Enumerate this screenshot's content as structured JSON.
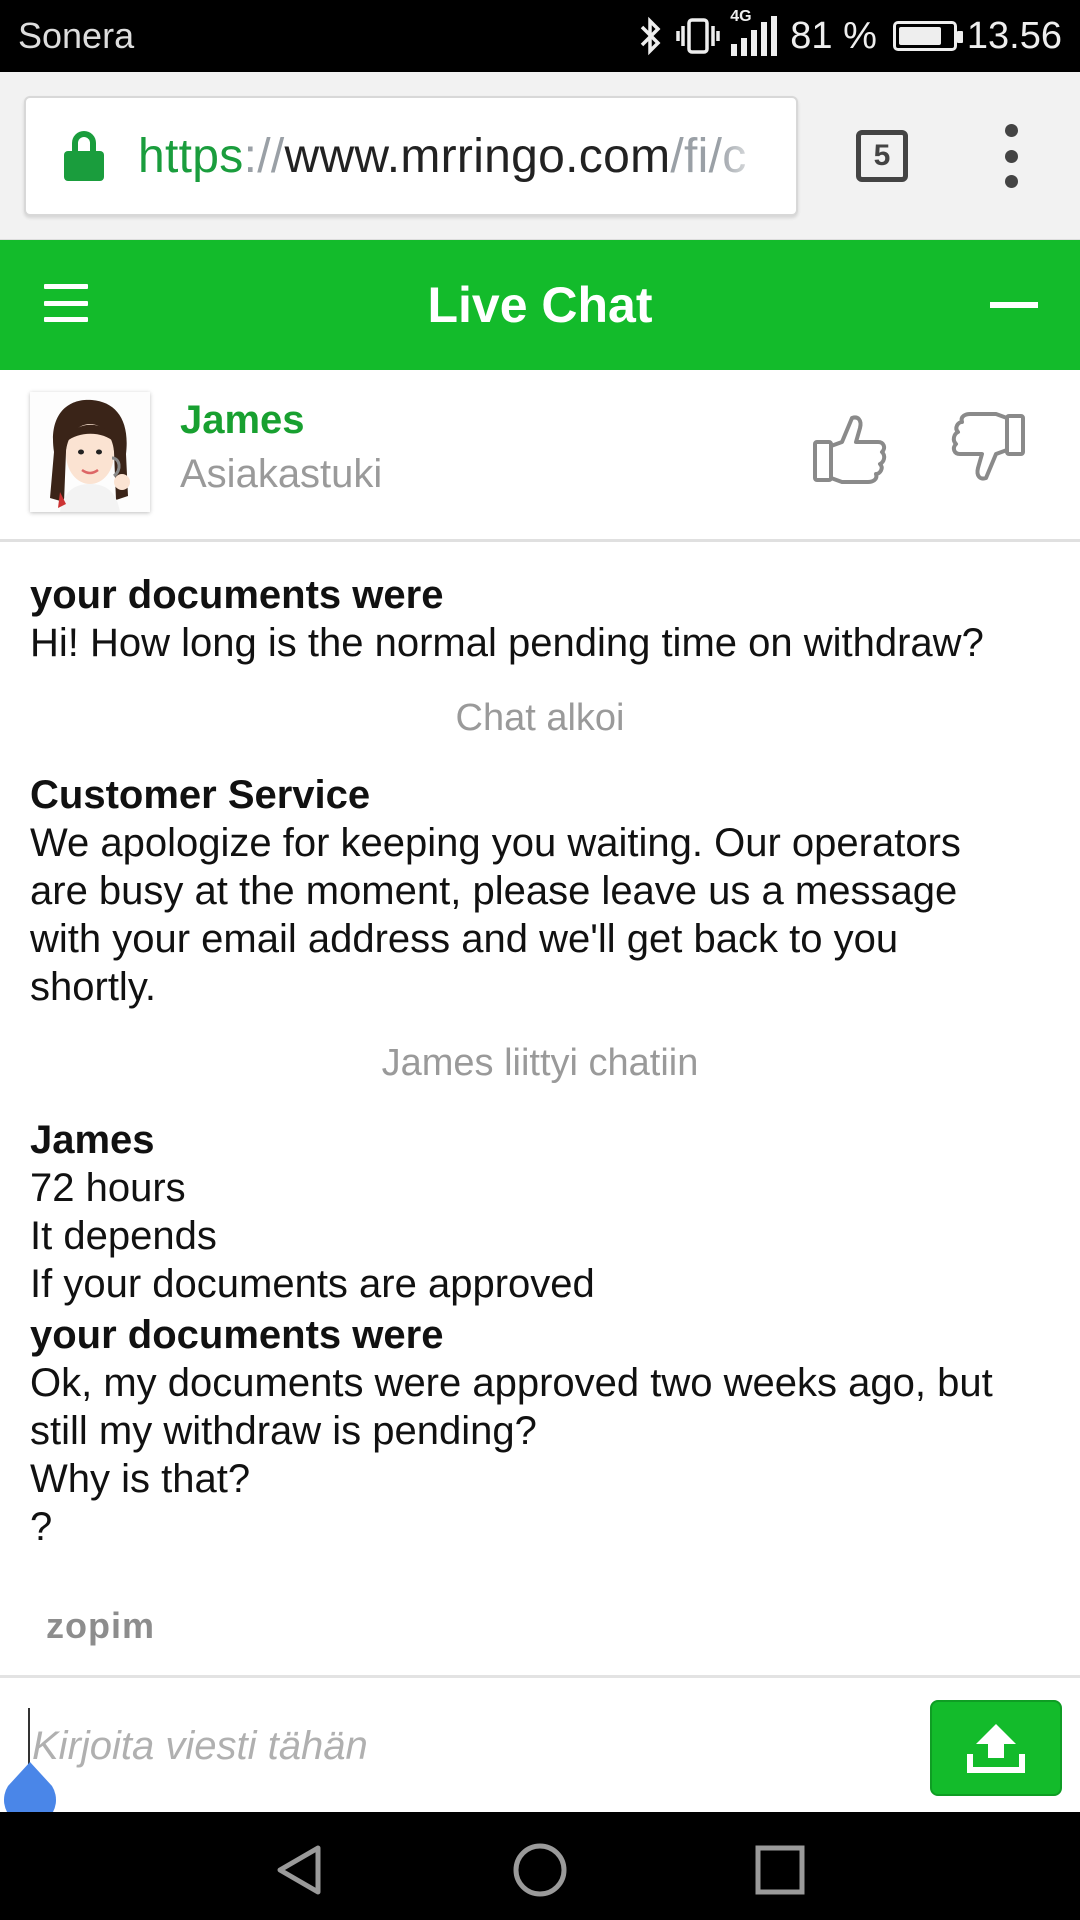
{
  "status_bar": {
    "carrier": "Sonera",
    "network": "4G",
    "battery_text": "81 %",
    "battery_level": 0.81,
    "time": "13.56",
    "icons": [
      "bluetooth-icon",
      "vibrate-icon",
      "signal-icon",
      "battery-icon"
    ]
  },
  "browser": {
    "url_scheme": "https",
    "url_sep": "://",
    "url_host": "www.mrringo.com",
    "url_path": "/fi/c",
    "tab_count": "5",
    "lock_color": "#1a9d3d"
  },
  "chat_header": {
    "title": "Live Chat",
    "accent": "#13bb2b"
  },
  "agent": {
    "name": "James",
    "role": "Asiakastuki"
  },
  "messages": [
    {
      "sender": "your documents were",
      "lines": [
        "Hi! How long is the normal pending time on withdraw?"
      ]
    },
    {
      "system": "Chat alkoi"
    },
    {
      "sender": "Customer Service",
      "lines": [
        "We apologize for keeping you waiting. Our operators",
        "are busy at the moment, please leave us a message",
        "with your email address and we'll get back to you",
        "shortly."
      ]
    },
    {
      "system": "James liittyi chatiin"
    },
    {
      "sender": "James",
      "lines": [
        "72 hours",
        "It depends",
        "If your documents are approved"
      ]
    },
    {
      "sender": "your documents were",
      "lines": [
        "Ok, my documents were approved two weeks ago, but",
        "still my withdraw is pending?",
        "Why is that?",
        "?"
      ]
    }
  ],
  "branding": {
    "zopim": "zopim"
  },
  "input": {
    "placeholder": "Kirjoita viesti tähän",
    "value": ""
  }
}
